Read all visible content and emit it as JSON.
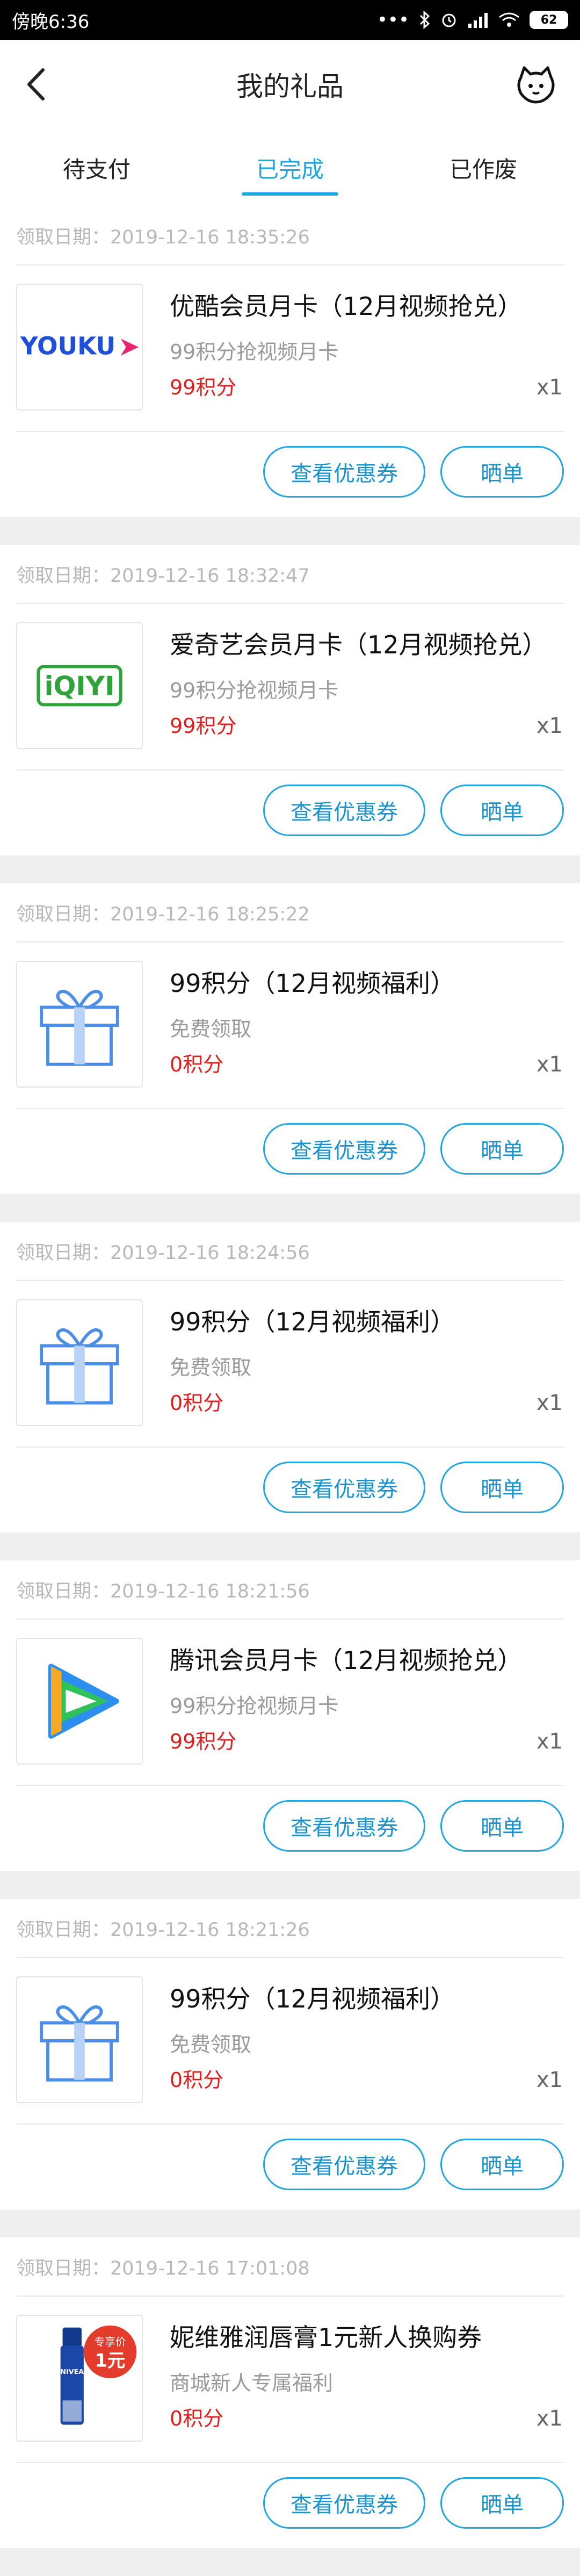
{
  "status_bar": {
    "time": "傍晚6:36",
    "battery": "62"
  },
  "nav": {
    "title": "我的礼品"
  },
  "tabs": [
    {
      "label": "待支付",
      "active": false
    },
    {
      "label": "已完成",
      "active": true
    },
    {
      "label": "已作废",
      "active": false
    }
  ],
  "items": [
    {
      "date": "领取日期：2019-12-16 18:35:26",
      "icon": "youku-logo",
      "name": "优酷会员月卡（12月视频抢兑）",
      "desc": "99积分抢视频月卡",
      "price": "99积分",
      "qty": "x1",
      "coupon_label": "查看优惠券",
      "share_label": "晒单"
    },
    {
      "date": "领取日期：2019-12-16 18:32:47",
      "icon": "iqiyi-logo",
      "name": "爱奇艺会员月卡（12月视频抢兑）",
      "desc": "99积分抢视频月卡",
      "price": "99积分",
      "qty": "x1",
      "coupon_label": "查看优惠券",
      "share_label": "晒单"
    },
    {
      "date": "领取日期：2019-12-16 18:25:22",
      "icon": "gift-box-icon",
      "name": "99积分（12月视频福利）",
      "desc": "免费领取",
      "price": "0积分",
      "qty": "x1",
      "coupon_label": "查看优惠券",
      "share_label": "晒单"
    },
    {
      "date": "领取日期：2019-12-16 18:24:56",
      "icon": "gift-box-icon",
      "name": "99积分（12月视频福利）",
      "desc": "免费领取",
      "price": "0积分",
      "qty": "x1",
      "coupon_label": "查看优惠券",
      "share_label": "晒单"
    },
    {
      "date": "领取日期：2019-12-16 18:21:56",
      "icon": "tencent-video-logo",
      "name": "腾讯会员月卡（12月视频抢兑）",
      "desc": "99积分抢视频月卡",
      "price": "99积分",
      "qty": "x1",
      "coupon_label": "查看优惠券",
      "share_label": "晒单"
    },
    {
      "date": "领取日期：2019-12-16 18:21:26",
      "icon": "gift-box-icon",
      "name": "99积分（12月视频福利）",
      "desc": "免费领取",
      "price": "0积分",
      "qty": "x1",
      "coupon_label": "查看优惠券",
      "share_label": "晒单"
    },
    {
      "date": "领取日期：2019-12-16 17:01:08",
      "icon": "nivea-lipbalm-image",
      "name": "妮维雅润唇膏1元新人换购券",
      "desc": "商城新人专属福利",
      "price": "0积分",
      "qty": "x1",
      "coupon_label": "查看优惠券",
      "share_label": "晒单",
      "badge": {
        "line1": "专享价",
        "line2": "1元"
      }
    }
  ],
  "logos": {
    "youku": "YOUKU",
    "iqiyi": "iQIYI",
    "nivea": "NIVEA"
  },
  "colors": {
    "accent": "#19a8e0",
    "price": "#e02020"
  }
}
